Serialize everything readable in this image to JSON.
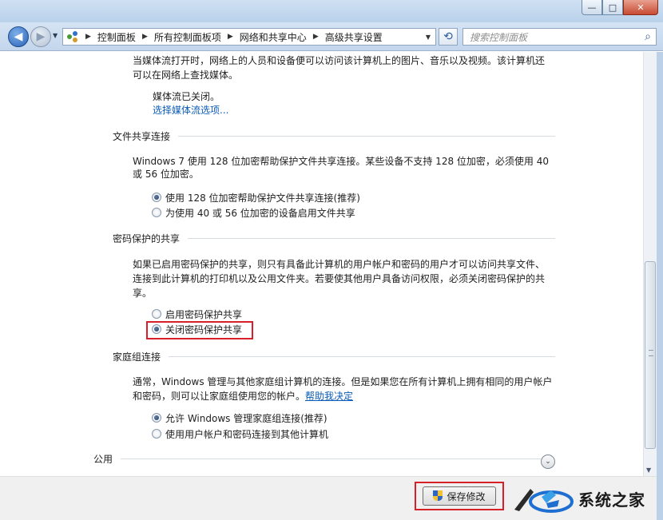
{
  "window": {
    "min_label": "—",
    "max_label": "□",
    "close_label": "✕"
  },
  "nav": {
    "breadcrumbs": [
      "控制面板",
      "所有控制面板项",
      "网络和共享中心",
      "高级共享设置"
    ],
    "search_placeholder": "搜索控制面板"
  },
  "media": {
    "line1": "当媒体流打开时，网络上的人员和设备便可以访问该计算机上的图片、音乐以及视频。该计算机还",
    "line2": "可以在网络上查找媒体。",
    "status": "媒体流已关闭。",
    "link": "选择媒体流选项..."
  },
  "file_sharing": {
    "title": "文件共享连接",
    "line1": "Windows 7 使用 128 位加密帮助保护文件共享连接。某些设备不支持 128 位加密，必须使用 40",
    "line2": "或 56 位加密。",
    "options": [
      {
        "label": "使用 128 位加密帮助保护文件共享连接(推荐)",
        "checked": true
      },
      {
        "label": "为使用 40 或 56 位加密的设备启用文件共享",
        "checked": false
      }
    ]
  },
  "password": {
    "title": "密码保护的共享",
    "line1": "如果已启用密码保护的共享，则只有具备此计算机的用户帐户和密码的用户才可以访问共享文件、",
    "line2": "连接到此计算机的打印机以及公用文件夹。若要使其他用户具备访问权限，必须关闭密码保护的共",
    "line3": "享。",
    "options": [
      {
        "label": "启用密码保护共享",
        "checked": false
      },
      {
        "label": "关闭密码保护共享",
        "checked": true
      }
    ]
  },
  "homegroup": {
    "title": "家庭组连接",
    "line1": "通常，Windows 管理与其他家庭组计算机的连接。但是如果您在所有计算机上拥有相同的用户帐户",
    "line2_prefix": "和密码，则可以让家庭组使用您的帐户。",
    "line2_link": "帮助我决定",
    "options": [
      {
        "label": "允许 Windows 管理家庭组连接(推荐)",
        "checked": true
      },
      {
        "label": "使用用户帐户和密码连接到其他计算机",
        "checked": false
      }
    ]
  },
  "public": {
    "title": "公用"
  },
  "footer": {
    "save_label": "保存修改",
    "watermark_text": "系统之家"
  },
  "colors": {
    "highlight": "#d8202a",
    "link": "#0b5cb8"
  }
}
